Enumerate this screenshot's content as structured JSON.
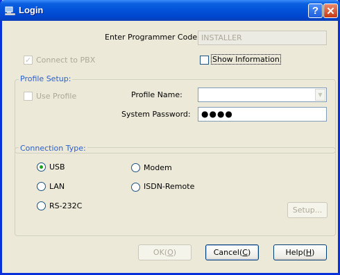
{
  "window": {
    "title": "Login"
  },
  "programmer_code": {
    "label": "Enter Programmer Code:",
    "value": "INSTALLER"
  },
  "connect_to_pbx": {
    "label": "Connect to PBX",
    "checked": true,
    "disabled": true
  },
  "show_information": {
    "label": "Show Information",
    "checked": false
  },
  "profile_setup": {
    "title": "Profile Setup:",
    "use_profile_label": "Use Profile",
    "profile_name_label": "Profile Name:",
    "profile_name_value": "",
    "system_password_label": "System Password:",
    "system_password_value": "●●●●"
  },
  "connection_type": {
    "title": "Connection Type:",
    "options": [
      "USB",
      "Modem",
      "LAN",
      "ISDN-Remote",
      "RS-232C"
    ],
    "selected": "USB",
    "setup_button": "Setup..."
  },
  "buttons": {
    "ok": {
      "label": "OK(",
      "mnemonic": "O",
      "suffix": ")"
    },
    "cancel": {
      "label": "Cancel(",
      "mnemonic": "C",
      "suffix": ")"
    },
    "help": {
      "label": "Help(",
      "mnemonic": "H",
      "suffix": ")"
    }
  },
  "colors": {
    "titlebar": "#0352d8",
    "dialog_bg": "#ece9d8",
    "group_title": "#2c5ec9",
    "radio_selected": "#21a121"
  },
  "icons": {
    "title": "login-icon",
    "help": "question-mark-icon",
    "close": "close-x-icon"
  }
}
